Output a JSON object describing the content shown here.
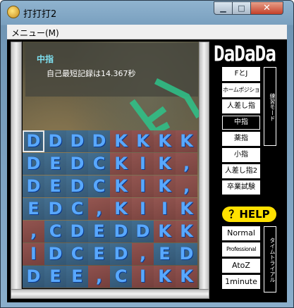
{
  "window": {
    "title": "打打打2",
    "close_symbol": "✕",
    "max_symbol": "□",
    "min_symbol": "▁"
  },
  "menu": {
    "items": [
      {
        "label": "メニュー(M)"
      }
    ]
  },
  "info": {
    "finger": "中指",
    "record": "自己最短記録は14.367秒"
  },
  "grid": {
    "rows": [
      [
        "D",
        "D",
        "D",
        "D",
        "K",
        "K",
        "K",
        "K"
      ],
      [
        "D",
        "E",
        "D",
        "C",
        "K",
        "I",
        "K",
        ","
      ],
      [
        "D",
        "E",
        "D",
        "C",
        "K",
        "I",
        "K",
        ","
      ],
      [
        "E",
        "D",
        "C",
        ",",
        "K",
        "I",
        "I",
        "K"
      ],
      [
        ",",
        "C",
        "D",
        "E",
        "D",
        "D",
        "K",
        "K"
      ],
      [
        "I",
        "D",
        "C",
        "E",
        "D",
        ",",
        "E",
        "D"
      ],
      [
        "D",
        "E",
        "E",
        ",",
        "C",
        "I",
        "K",
        "K"
      ]
    ],
    "shades": [
      [
        "b",
        "b",
        "b",
        "b",
        "r",
        "r",
        "r",
        "r"
      ],
      [
        "b",
        "b",
        "b",
        "b",
        "r",
        "r",
        "r",
        "r"
      ],
      [
        "b",
        "b",
        "b",
        "b",
        "r",
        "r",
        "r",
        "r"
      ],
      [
        "b",
        "b",
        "b",
        "r",
        "r",
        "r",
        "r",
        "r"
      ],
      [
        "r",
        "b",
        "b",
        "b",
        "b",
        "b",
        "r",
        "r"
      ],
      [
        "r",
        "b",
        "b",
        "b",
        "b",
        "r",
        "b",
        "b"
      ],
      [
        "b",
        "b",
        "b",
        "r",
        "b",
        "r",
        "r",
        "r"
      ]
    ],
    "cursor": [
      0,
      0
    ]
  },
  "sidebar": {
    "logo": "DaDaDa",
    "practice_label": "練習モード",
    "modes": [
      {
        "label": "FとJ"
      },
      {
        "label": "ホームポジション"
      },
      {
        "label": "人差し指"
      },
      {
        "label": "中指"
      },
      {
        "label": "薬指"
      },
      {
        "label": "小指"
      },
      {
        "label": "人差し指2"
      },
      {
        "label": "卒業試験"
      }
    ],
    "selected_mode": "中指",
    "help": "？HELP",
    "time_trial_label": "タイムトライアル",
    "difficulties": [
      {
        "label": "Normal"
      },
      {
        "label": "Professional"
      },
      {
        "label": "AtoZ"
      },
      {
        "label": "1minute"
      }
    ]
  }
}
